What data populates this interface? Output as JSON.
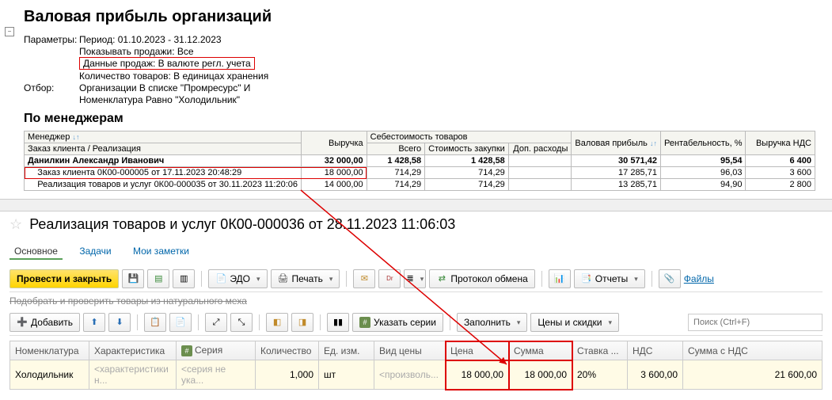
{
  "report": {
    "title": "Валовая прибыль организаций",
    "subtitle": "По менеджерам",
    "params_label": "Параметры:",
    "filter_label": "Отбор:",
    "period": "Период: 01.10.2023 - 31.12.2023",
    "show_sales": "Показывать продажи: Все",
    "sales_data": "Данные продаж: В валюте регл. учета",
    "qty": "Количество товаров: В единицах хранения",
    "filter1": "Организации В списке \"Промресурс\" И",
    "filter2": "Номенклатура Равно \"Холодильник\"",
    "cols": {
      "manager": "Менеджер",
      "order": "Заказ клиента / Реализация",
      "revenue": "Выручка",
      "cost_group": "Себестоимость товаров",
      "cost_total": "Всего",
      "cost_purchase": "Стоимость закупки",
      "cost_extra": "Доп. расходы",
      "gross": "Валовая прибыль",
      "rent": "Рентабельность, %",
      "revenue_nds": "Выручка НДС"
    },
    "rows": [
      {
        "label": "Данилкин Александр Иванович",
        "rev": "32 000,00",
        "c1": "1 428,58",
        "c2": "1 428,58",
        "c3": "",
        "gross": "30 571,42",
        "rent": "95,54",
        "nds": "6 400",
        "bold": true
      },
      {
        "label": "Заказ клиента 0К00-000005 от 17.11.2023 20:48:29",
        "rev": "18 000,00",
        "c1": "714,29",
        "c2": "714,29",
        "c3": "",
        "gross": "17 285,71",
        "rent": "96,03",
        "nds": "3 600",
        "hi": true
      },
      {
        "label": "Реализация товаров и услуг 0К00-000035 от 30.11.2023 11:20:06",
        "rev": "14 000,00",
        "c1": "714,29",
        "c2": "714,29",
        "c3": "",
        "gross": "13 285,71",
        "rent": "94,90",
        "nds": "2 800"
      }
    ]
  },
  "doc": {
    "title": "Реализация товаров и услуг 0К00-000036 от 28.11.2023 11:06:03",
    "tabs": {
      "main": "Основное",
      "tasks": "Задачи",
      "notes": "Мои заметки"
    },
    "toolbar": {
      "post_close": "Провести и закрыть",
      "edo": "ЭДО",
      "print": "Печать",
      "protocol": "Протокол обмена",
      "reports": "Отчеты",
      "files": "Файлы"
    },
    "crossed": "Подобрать и проверить товары из натурального меха",
    "toolbar2": {
      "add": "Добавить",
      "series": "Указать серии",
      "fill": "Заполнить",
      "prices": "Цены и скидки",
      "search_ph": "Поиск (Ctrl+F)"
    },
    "cols": {
      "nomen": "Номенклатура",
      "char": "Характеристика",
      "series": "Серия",
      "qty": "Количество",
      "unit": "Ед. изм.",
      "price_type": "Вид цены",
      "price": "Цена",
      "sum": "Сумма",
      "rate": "Ставка ...",
      "nds": "НДС",
      "sum_nds": "Сумма с НДС"
    },
    "row": {
      "nomen": "Холодильник",
      "char": "<характеристики н...",
      "series": "<серия не ука...",
      "qty": "1,000",
      "unit": "шт",
      "price_type": "<произволь...",
      "price": "18 000,00",
      "sum": "18 000,00",
      "rate": "20%",
      "nds": "3 600,00",
      "sum_nds": "21 600,00"
    }
  }
}
